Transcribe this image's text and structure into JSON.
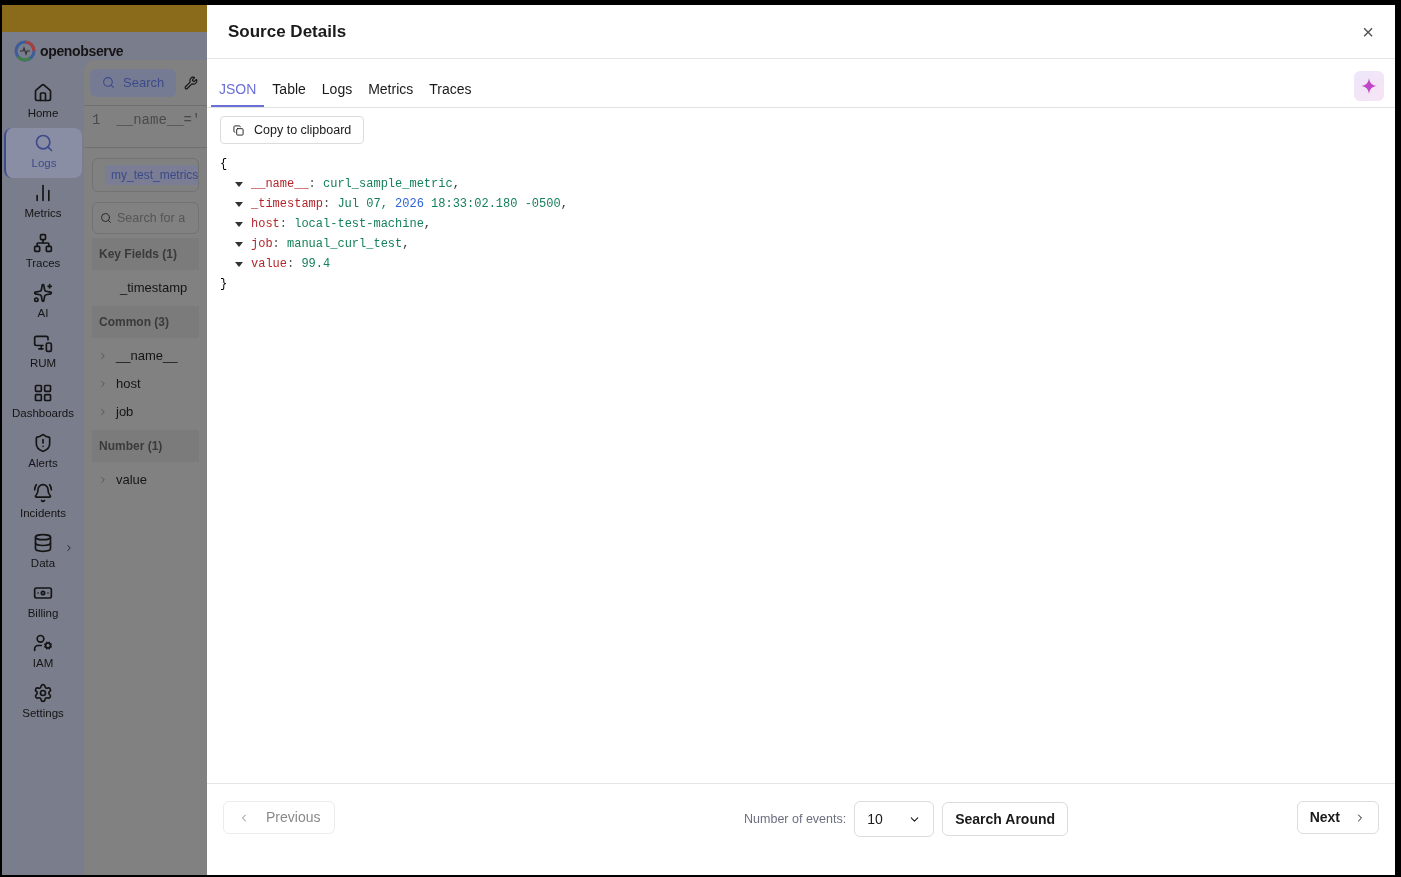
{
  "app": {
    "logo": "openobserve"
  },
  "nav": [
    {
      "label": "Home",
      "selected": false,
      "submenu": false
    },
    {
      "label": "Logs",
      "selected": true,
      "submenu": false
    },
    {
      "label": "Metrics",
      "selected": false,
      "submenu": false
    },
    {
      "label": "Traces",
      "selected": false,
      "submenu": false
    },
    {
      "label": "AI",
      "selected": false,
      "submenu": false
    },
    {
      "label": "RUM",
      "selected": false,
      "submenu": false
    },
    {
      "label": "Dashboards",
      "selected": false,
      "submenu": false
    },
    {
      "label": "Alerts",
      "selected": false,
      "submenu": false
    },
    {
      "label": "Incidents",
      "selected": false,
      "submenu": false
    },
    {
      "label": "Data",
      "selected": false,
      "submenu": true
    },
    {
      "label": "Billing",
      "selected": false,
      "submenu": false
    },
    {
      "label": "IAM",
      "selected": false,
      "submenu": false
    },
    {
      "label": "Settings",
      "selected": false,
      "submenu": false
    }
  ],
  "logs_panel": {
    "search_button": "Search",
    "query_line_number": "1",
    "query": "__name__='",
    "stream": "my_test_metrics",
    "field_search": {
      "placeholder": "Search for a"
    },
    "groups": [
      {
        "title": "Key Fields (1)",
        "fields": [
          {
            "name": "_timestamp",
            "expandable": false
          }
        ]
      },
      {
        "title": "Common (3)",
        "fields": [
          {
            "name": "__name__",
            "expandable": true
          },
          {
            "name": "host",
            "expandable": true
          },
          {
            "name": "job",
            "expandable": true
          }
        ]
      },
      {
        "title": "Number (1)",
        "fields": [
          {
            "name": "value",
            "expandable": true
          }
        ]
      }
    ]
  },
  "dialog": {
    "title": "Source Details",
    "close": "×",
    "tabs": [
      {
        "label": "JSON",
        "selected": true
      },
      {
        "label": "Table",
        "selected": false
      },
      {
        "label": "Logs",
        "selected": false
      },
      {
        "label": "Metrics",
        "selected": false
      },
      {
        "label": "Traces",
        "selected": false
      }
    ],
    "copy_button": "Copy to clipboard",
    "json": {
      "open": "{",
      "close": "}",
      "fields": [
        {
          "key": "__name__",
          "separator": ":",
          "value": [
            {
              "text": "curl_sample_metric",
              "kind": "string"
            }
          ],
          "end": ","
        },
        {
          "key": "_timestamp",
          "separator": ":",
          "value": [
            {
              "text": "Jul 07, ",
              "kind": "string"
            },
            {
              "text": "2026",
              "kind": "number"
            },
            {
              "text": " 18:33:02.180 -0500",
              "kind": "string"
            }
          ],
          "end": ","
        },
        {
          "key": "host",
          "separator": ":",
          "value": [
            {
              "text": "local-test-machine",
              "kind": "string"
            }
          ],
          "end": ","
        },
        {
          "key": "job",
          "separator": ":",
          "value": [
            {
              "text": "manual_curl_test",
              "kind": "string"
            }
          ],
          "end": ","
        },
        {
          "key": "value",
          "separator": ":",
          "value": [
            {
              "text": "99.4",
              "kind": "string"
            }
          ]
        }
      ]
    },
    "footer": {
      "previous": {
        "label": "Previous",
        "disabled": true
      },
      "events_label": "Number of events:",
      "events_value": "10",
      "search_around": "Search Around",
      "next": {
        "label": "Next",
        "disabled": false
      }
    }
  }
}
